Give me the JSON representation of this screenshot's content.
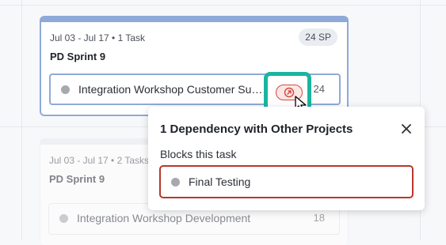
{
  "sprint_cards": [
    {
      "date_range": "Jul 03 - Jul 17 • 1 Task",
      "name": "PD Sprint 9",
      "story_points": "24 SP",
      "task": {
        "title": "Integration Workshop Customer Support",
        "points": "24"
      }
    },
    {
      "date_range": "Jul 03 - Jul 17 • 2 Tasks",
      "name": "PD Sprint 9",
      "task": {
        "title": "Integration Workshop Development",
        "points": "18"
      }
    }
  ],
  "dependency_popover": {
    "title": "1 Dependency with Other Projects",
    "section_label": "Blocks this task",
    "items": [
      {
        "title": "Final Testing"
      }
    ]
  },
  "icons": {
    "dependency": "external-link-circle-icon",
    "close": "close-icon",
    "cursor": "mouse-pointer-icon"
  },
  "colors": {
    "highlight": "#1ab5a0",
    "dependency_red": "#d14a3f",
    "active_border": "#8faad8"
  }
}
